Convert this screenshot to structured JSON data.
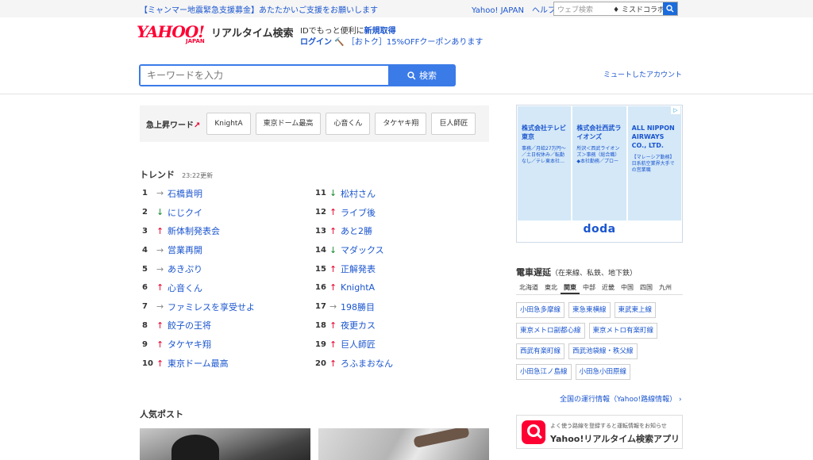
{
  "topbar": {
    "notice": "【ミャンマー地震緊急支援募金】あたたかいご支援をお願いします",
    "links": [
      "Yahoo! JAPAN",
      "ヘルプ"
    ],
    "web_search_placeholder": "ウェブ検索",
    "web_search_keyword": "ミスドコラボ"
  },
  "header": {
    "logo_text": "YAHOO!",
    "logo_sub": "JAPAN",
    "service_name": "リアルタイム検索",
    "id_message_prefix": "IDでもっと便利に",
    "id_message_link": "新規取得",
    "login": "ログイン",
    "coupon": "［おトク］15%OFFクーポンあります"
  },
  "search": {
    "placeholder": "キーワードを入力",
    "button_label": "検索",
    "mute_link": "ミュートしたアカウント"
  },
  "rising": {
    "label": "急上昇ワード",
    "words": [
      "KnightA",
      "東京ドーム最高",
      "心音くん",
      "タケヤキ翔",
      "巨人師匠"
    ]
  },
  "trend": {
    "title": "トレンド",
    "updated": "23:22更新",
    "left": [
      {
        "rank": "1",
        "dir": "flat",
        "word": "石橋貴明"
      },
      {
        "rank": "2",
        "dir": "down",
        "word": "にじクイ"
      },
      {
        "rank": "3",
        "dir": "up",
        "word": "新体制発表会"
      },
      {
        "rank": "4",
        "dir": "flat",
        "word": "営業再開"
      },
      {
        "rank": "5",
        "dir": "flat",
        "word": "あきぷり"
      },
      {
        "rank": "6",
        "dir": "up",
        "word": "心音くん"
      },
      {
        "rank": "7",
        "dir": "flat",
        "word": "ファミレスを享受せよ"
      },
      {
        "rank": "8",
        "dir": "up",
        "word": "餃子の王将"
      },
      {
        "rank": "9",
        "dir": "up",
        "word": "タケヤキ翔"
      },
      {
        "rank": "10",
        "dir": "up",
        "word": "東京ドーム最高"
      }
    ],
    "right": [
      {
        "rank": "11",
        "dir": "down",
        "word": "松村さん"
      },
      {
        "rank": "12",
        "dir": "up",
        "word": "ライブ後"
      },
      {
        "rank": "13",
        "dir": "up",
        "word": "あと2勝"
      },
      {
        "rank": "14",
        "dir": "down",
        "word": "マダックス"
      },
      {
        "rank": "15",
        "dir": "up",
        "word": "正解発表"
      },
      {
        "rank": "16",
        "dir": "up",
        "word": "KnightA"
      },
      {
        "rank": "17",
        "dir": "flat",
        "word": "198勝目"
      },
      {
        "rank": "18",
        "dir": "up",
        "word": "夜更カス"
      },
      {
        "rank": "19",
        "dir": "up",
        "word": "巨人師匠"
      },
      {
        "rank": "20",
        "dir": "up",
        "word": "ろふまおなん"
      }
    ]
  },
  "popular": {
    "title": "人気ポスト"
  },
  "ad": {
    "cards": [
      {
        "name": "株式会社テレビ東京",
        "desc": "事務／月給27万円〜／土日祝休み／転勤なし／テレ東本社…"
      },
      {
        "name": "株式会社西武ライオンズ",
        "desc": "所沢＜西武ライオンズ＞事務（総合職）◆本社勤務／プロー"
      },
      {
        "name": "ALL NIPPON AIRWAYS CO., LTD.",
        "desc": "【マレーシア勤務】日系航空業界大手での営業職"
      }
    ],
    "brand": "doda",
    "choice": "▷"
  },
  "train": {
    "title": "電車遅延",
    "subtitle": "（在来線、私鉄、地下鉄）",
    "regions": [
      "北海道",
      "東北",
      "関東",
      "中部",
      "近畿",
      "中国",
      "四国",
      "九州"
    ],
    "active_region": "関東",
    "rows": [
      [
        "小田急多摩線",
        "東急東横線",
        "東武東上線"
      ],
      [
        "東京メトロ副都心線",
        "東京メトロ有楽町線"
      ],
      [
        "西武有楽町線",
        "西武池袋線・秩父線"
      ],
      [
        "小田急江ノ島線",
        "小田急小田原線"
      ]
    ],
    "all_link": "全国の運行情報（Yahoo!路線情報）",
    "app_desc": "よく使う路線を登録すると運転情報をお知らせ",
    "app_name": "Yahoo!リアルタイム検索アプリ"
  },
  "colors": {
    "accent": "#3b7be8",
    "link": "#1a55cf",
    "up": "#e6002d",
    "down": "#1a8a2e"
  }
}
